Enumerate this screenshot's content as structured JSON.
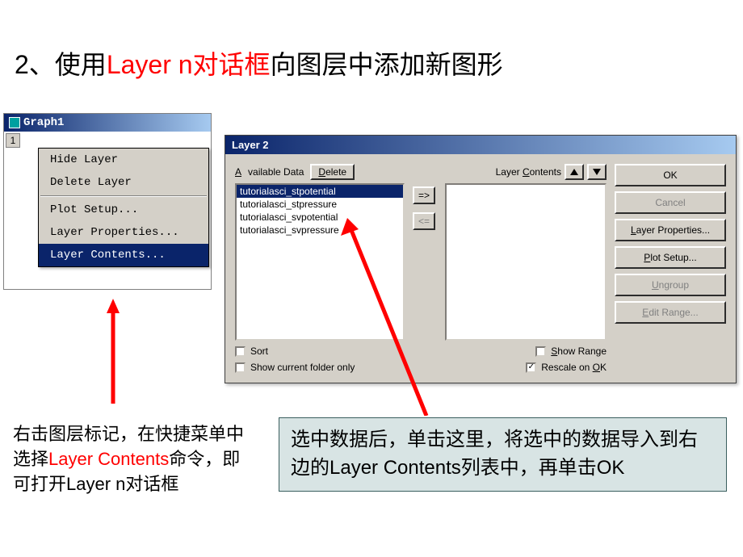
{
  "title": {
    "prefix": "2、使用",
    "highlight": "Layer n对话框",
    "suffix": "向图层中添加新图形"
  },
  "graph_window": {
    "title": "Graph1",
    "layer_number": "1",
    "menu": {
      "hide": "Hide Layer",
      "delete": "Delete Layer",
      "plot_setup": "Plot Setup...",
      "layer_properties": "Layer Properties...",
      "layer_contents": "Layer Contents..."
    }
  },
  "dialog": {
    "title": "Layer 2",
    "available_label": "Available Data",
    "delete_btn": "Delete",
    "contents_label": "Layer Contents",
    "move_right": "=>",
    "move_left": "<=",
    "items": [
      "tutorialasci_stpotential",
      "tutorialasci_stpressure",
      "tutorialasci_svpotential",
      "tutorialasci_svpressure"
    ],
    "sort": "Sort",
    "show_folder": "Show current folder only",
    "show_range": "Show Range",
    "rescale": "Rescale on OK",
    "buttons": {
      "ok": "OK",
      "cancel": "Cancel",
      "layer_props": "Layer Properties...",
      "plot_setup": "Plot Setup...",
      "ungroup": "Ungroup",
      "edit_range": "Edit Range..."
    }
  },
  "annotation1": {
    "p1": "右击图层标记，在快捷菜单中选择",
    "p2": "Layer Contents",
    "p3": "命令，即可打开Layer n对话框"
  },
  "annotation2": "选中数据后，单击这里，将选中的数据导入到右边的Layer Contents列表中，再单击OK"
}
